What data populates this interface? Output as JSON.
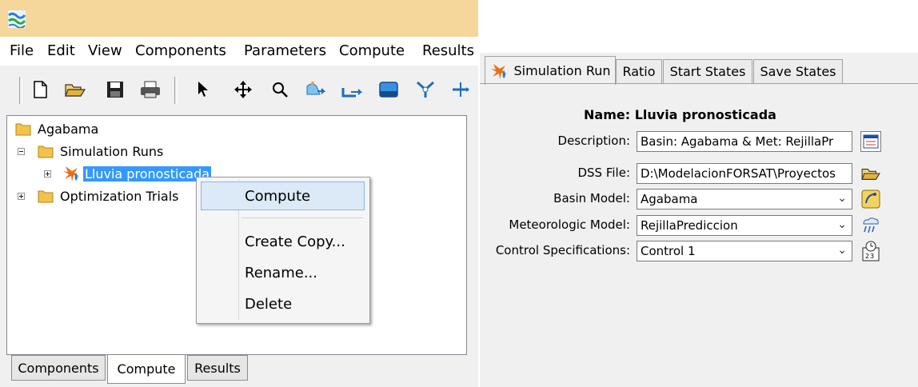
{
  "menu": [
    "File",
    "Edit",
    "View",
    "Components",
    "Parameters",
    "Compute",
    "Results"
  ],
  "toolbar": {
    "icons": [
      "new-file-icon",
      "open-folder-icon",
      "save-icon",
      "print-icon",
      "select-arrow-icon",
      "pan-move-icon",
      "zoom-icon",
      "add-subbasin-icon",
      "add-reach-icon",
      "add-reservoir-icon",
      "add-junction-icon",
      "add-diversion-icon"
    ]
  },
  "tree": {
    "root": "Agabama",
    "simulation_runs": "Simulation Runs",
    "run": "Lluvia pronosticada",
    "optimization": "Optimization Trials"
  },
  "context_menu": {
    "compute": "Compute",
    "create_copy": "Create Copy...",
    "rename": "Rename...",
    "delete": "Delete"
  },
  "bottom_tabs": [
    "Components",
    "Compute",
    "Results"
  ],
  "right_tabs": [
    "Simulation Run",
    "Ratio",
    "Start States",
    "Save States"
  ],
  "run_panel": {
    "name_label": "Name:",
    "name_value": "Lluvia pronosticada",
    "description_label": "Description:",
    "description_value": "Basin: Agabama  & Met: RejillaPr",
    "dss_label": "DSS File:",
    "dss_value": "D:\\ModelacionFORSAT\\Proyectos",
    "basin_label": "Basin Model:",
    "basin_value": "Agabama",
    "met_label": "Meteorologic Model:",
    "met_value": "RejillaPrediccion",
    "control_label": "Control Specifications:",
    "control_value": "Control 1"
  },
  "colors": {
    "titlebar": "#f6d79b",
    "selection": "#3399ff",
    "menu_highlight": "#dceaf8"
  }
}
